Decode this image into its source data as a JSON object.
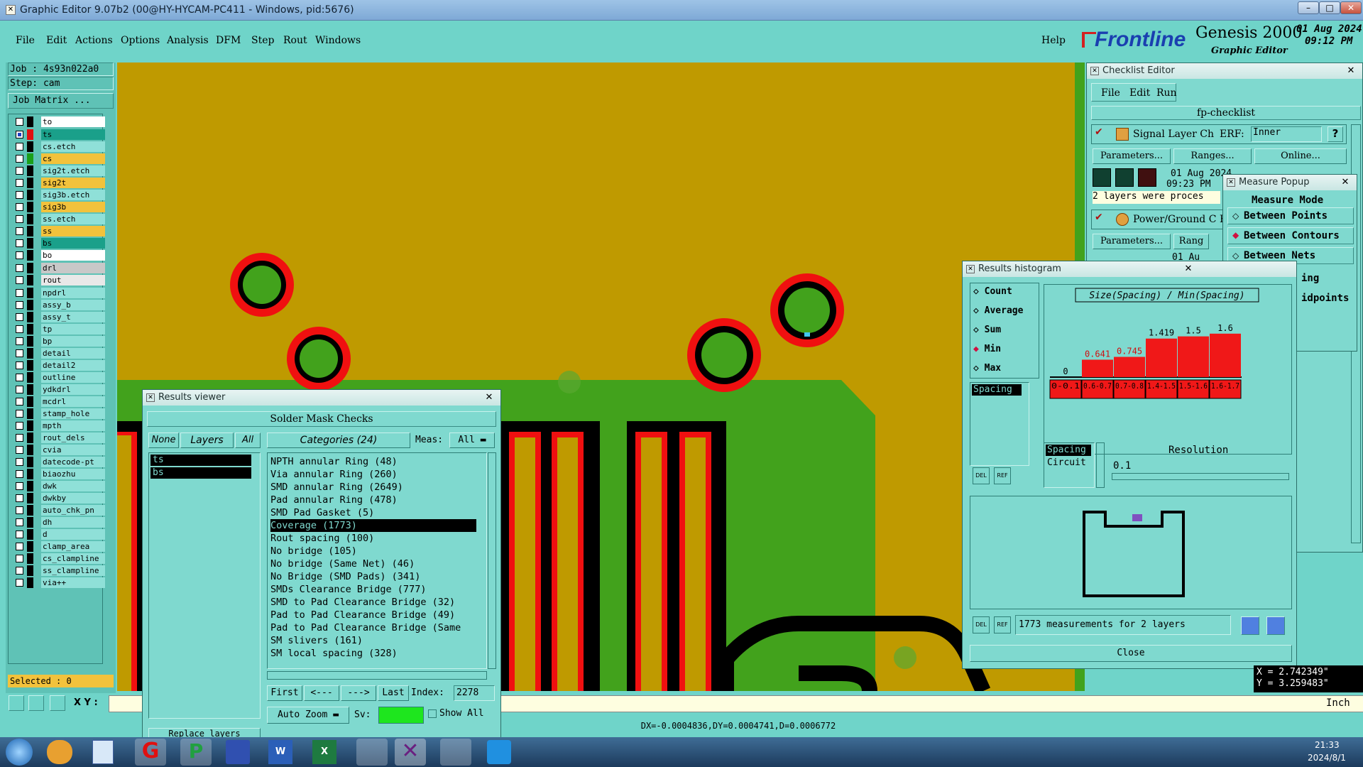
{
  "window": {
    "title": "Graphic Editor 9.07b2 (00@HY-HYCAM-PC411 - Windows, pid:5676)"
  },
  "menu": [
    "File",
    "Edit",
    "Actions",
    "Options",
    "Analysis",
    "DFM",
    "Step",
    "Rout",
    "Windows"
  ],
  "help": "Help",
  "brand": {
    "logo": "Frontline",
    "product": "Genesis 2000",
    "subtitle": "Graphic Editor",
    "date": "01 Aug 2024",
    "time": "09:12 PM"
  },
  "job": {
    "job_label": "Job : 4s93n022a0",
    "step_label": "Step: cam",
    "matrix_button": "Job Matrix ..."
  },
  "layers": [
    {
      "name": "to",
      "color": "#ffffff",
      "swatch": "#000000"
    },
    {
      "name": "ts",
      "color": "#1aa08a",
      "swatch": "#e01010",
      "checked": true
    },
    {
      "name": "cs.etch",
      "color": "#8fe0d8",
      "swatch": "#000000"
    },
    {
      "name": "cs",
      "color": "#f2c23c",
      "swatch": "#1aa01a"
    },
    {
      "name": "sig2t.etch",
      "color": "#8fe0d8",
      "swatch": "#000000"
    },
    {
      "name": "sig2t",
      "color": "#f2c23c",
      "swatch": "#000000"
    },
    {
      "name": "sig3b.etch",
      "color": "#8fe0d8",
      "swatch": "#000000"
    },
    {
      "name": "sig3b",
      "color": "#f2c23c",
      "swatch": "#000000"
    },
    {
      "name": "ss.etch",
      "color": "#8fe0d8",
      "swatch": "#000000"
    },
    {
      "name": "ss",
      "color": "#f2c23c",
      "swatch": "#000000"
    },
    {
      "name": "bs",
      "color": "#1aa08a",
      "swatch": "#000000"
    },
    {
      "name": "bo",
      "color": "#ffffff",
      "swatch": "#000000"
    },
    {
      "name": "drl",
      "color": "#c8c8c8",
      "swatch": "#000000"
    },
    {
      "name": "rout",
      "color": "#e8e8e8",
      "swatch": "#000000"
    },
    {
      "name": "npdrl",
      "color": "#8fe0d8",
      "swatch": "#000000"
    },
    {
      "name": "assy_b",
      "color": "#8fe0d8",
      "swatch": "#000000"
    },
    {
      "name": "assy_t",
      "color": "#8fe0d8",
      "swatch": "#000000"
    },
    {
      "name": "tp",
      "color": "#8fe0d8",
      "swatch": "#000000"
    },
    {
      "name": "bp",
      "color": "#8fe0d8",
      "swatch": "#000000"
    },
    {
      "name": "detail",
      "color": "#8fe0d8",
      "swatch": "#000000"
    },
    {
      "name": "detail2",
      "color": "#8fe0d8",
      "swatch": "#000000"
    },
    {
      "name": "outline",
      "color": "#8fe0d8",
      "swatch": "#000000"
    },
    {
      "name": "ydkdrl",
      "color": "#8fe0d8",
      "swatch": "#000000"
    },
    {
      "name": "mcdrl",
      "color": "#8fe0d8",
      "swatch": "#000000"
    },
    {
      "name": "stamp_hole",
      "color": "#8fe0d8",
      "swatch": "#000000"
    },
    {
      "name": "mpth",
      "color": "#8fe0d8",
      "swatch": "#000000"
    },
    {
      "name": "rout_dels",
      "color": "#8fe0d8",
      "swatch": "#000000"
    },
    {
      "name": "cvia",
      "color": "#8fe0d8",
      "swatch": "#000000"
    },
    {
      "name": "datecode-pt",
      "color": "#8fe0d8",
      "swatch": "#000000"
    },
    {
      "name": "biaozhu",
      "color": "#8fe0d8",
      "swatch": "#000000"
    },
    {
      "name": "dwk",
      "color": "#8fe0d8",
      "swatch": "#000000"
    },
    {
      "name": "dwkby",
      "color": "#8fe0d8",
      "swatch": "#000000"
    },
    {
      "name": "auto_chk_pn",
      "color": "#8fe0d8",
      "swatch": "#000000"
    },
    {
      "name": "dh",
      "color": "#8fe0d8",
      "swatch": "#000000"
    },
    {
      "name": "d",
      "color": "#8fe0d8",
      "swatch": "#000000"
    },
    {
      "name": "clamp_area",
      "color": "#8fe0d8",
      "swatch": "#000000"
    },
    {
      "name": "cs_clampline",
      "color": "#8fe0d8",
      "swatch": "#000000"
    },
    {
      "name": "ss_clampline",
      "color": "#8fe0d8",
      "swatch": "#000000"
    },
    {
      "name": "via++",
      "color": "#8fe0d8",
      "swatch": "#000000"
    }
  ],
  "selected": "Selected : 0",
  "xy_label": "X Y :",
  "status_line": "DX=-0.0004836,DY=0.0004741,D=0.0006772",
  "coords": {
    "x": "X = 2.742349\"",
    "y": "Y = 3.259483\""
  },
  "units": "Inch",
  "results_viewer": {
    "title": "Results viewer",
    "header": "Solder Mask Checks",
    "none": "None",
    "layers": "Layers",
    "all": "All",
    "categories_btn": "Categories (24)",
    "meas_label": "Meas:",
    "meas_value": "All",
    "layer_list": [
      "ts",
      "bs"
    ],
    "categories": [
      "NPTH annular Ring (48)",
      "Via annular Ring (260)",
      "SMD annular Ring (2649)",
      "Pad annular Ring (478)",
      "SMD Pad Gasket (5)",
      "Coverage (1773)",
      "Rout spacing (100)",
      "No bridge (105)",
      "No bridge (Same Net) (46)",
      "No Bridge (SMD Pads) (341)",
      "SMDs Clearance Bridge (777)",
      "SMD to Pad Clearance Bridge (32)",
      "Pad to Pad Clearance Bridge (49)",
      "Pad to Pad Clearance Bridge (Same",
      "SM slivers (161)",
      "SM local spacing (328)"
    ],
    "selected_index": 5,
    "first": "First",
    "prev": "<---",
    "next": "--->",
    "last": "Last",
    "index_label": "Index:",
    "index_value": "2278",
    "autozoom": "Auto Zoom",
    "sv": "Sv:",
    "show_all": "Show All",
    "replace_layers": "Replace layers"
  },
  "checklist": {
    "title": "Checklist Editor",
    "menu": [
      "File",
      "Edit",
      "Run"
    ],
    "name": "fp-checklist",
    "row1": {
      "label": "Signal Layer Ch",
      "erf": "ERF:",
      "erf_value": "Inner"
    },
    "params": "Parameters...",
    "ranges": "Ranges...",
    "online": "Online...",
    "date": "01 Aug 2024",
    "time": "09:23 PM",
    "status": "2 layers were proces",
    "row2": {
      "label": "Power/Ground C",
      "erf": "E"
    },
    "ranges2": "Rang",
    "date2": "01 Au"
  },
  "measure": {
    "title": "Measure Popup",
    "mode": "Measure Mode",
    "options": [
      "Between Points",
      "Between Contours",
      "Between Nets"
    ],
    "selected": 1,
    "partial": [
      "ing",
      "idpoints"
    ]
  },
  "histogram": {
    "title": "Results histogram",
    "radios": [
      "Count",
      "Average",
      "Sum",
      "Min",
      "Max"
    ],
    "selected_radio": 3,
    "chart_title": "Size(Spacing) / Min(Spacing)",
    "left_list": [
      "Spacing"
    ],
    "res_list": [
      "Spacing",
      "Circuit"
    ],
    "resolution_label": "Resolution",
    "resolution_value": "0.1",
    "summary": "1773 measurements for 2 layers",
    "close": "Close",
    "del": "DEL",
    "ref": "REF"
  },
  "chart_data": {
    "type": "bar",
    "title": "Size(Spacing) / Min(Spacing)",
    "categories": [
      "0-0.1",
      "0.6-0.7",
      "0.7-0.8",
      "1.4-1.5",
      "1.5-1.6",
      "1.6-1.7"
    ],
    "values": [
      0,
      0.641,
      0.745,
      1.419,
      1.5,
      1.6
    ],
    "ylim": [
      0,
      1.7
    ],
    "bar_color": "#f01818"
  },
  "taskbar": {
    "time": "21:33",
    "date": "2024/8/1"
  }
}
